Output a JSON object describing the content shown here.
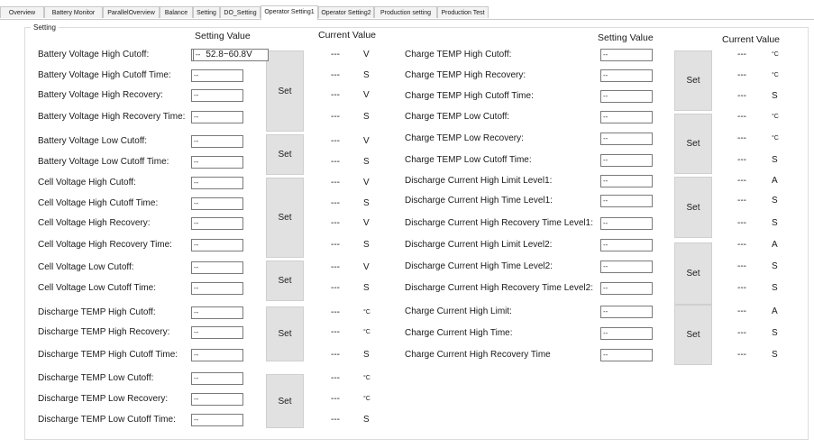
{
  "tabs": [
    "Overview",
    "Battery Monitor",
    "ParallelOverview",
    "Balance",
    "Setting",
    "DO_Setting",
    "Operator Setting1",
    "Operator Setting2",
    "Production setting",
    "Production Test"
  ],
  "active_tab": "Operator Setting1",
  "group_title": "Setting",
  "headers": {
    "setting_value": "Setting Value",
    "current_value": "Current Value"
  },
  "placeholder": "--",
  "current_placeholder": "---",
  "set_label": "Set",
  "tooltip": "52.8~60.8V",
  "left_rows": [
    {
      "label": "Battery Voltage High Cutoff:",
      "unit": "V"
    },
    {
      "label": "Battery Voltage High Cutoff Time:",
      "unit": "S"
    },
    {
      "label": "Battery Voltage High Recovery:",
      "unit": "V"
    },
    {
      "label": "Battery Voltage High Recovery Time:",
      "unit": "S"
    },
    {
      "label": "Battery Voltage Low Cutoff:",
      "unit": "V"
    },
    {
      "label": "Battery Voltage Low Cutoff Time:",
      "unit": "S"
    },
    {
      "label": "Cell Voltage High Cutoff:",
      "unit": "V"
    },
    {
      "label": "Cell Voltage High Cutoff Time:",
      "unit": "S"
    },
    {
      "label": "Cell Voltage High Recovery:",
      "unit": "V"
    },
    {
      "label": "Cell Voltage High Recovery Time:",
      "unit": "S"
    },
    {
      "label": "Cell Voltage Low Cutoff:",
      "unit": "V"
    },
    {
      "label": "Cell Voltage Low Cutoff Time:",
      "unit": "S"
    },
    {
      "label": "Discharge TEMP High Cutoff:",
      "unit": "°C"
    },
    {
      "label": "Discharge TEMP High Recovery:",
      "unit": "°C"
    },
    {
      "label": "Discharge TEMP High Cutoff Time:",
      "unit": "S"
    },
    {
      "label": "Discharge TEMP Low Cutoff:",
      "unit": "°C"
    },
    {
      "label": "Discharge TEMP Low Recovery:",
      "unit": "°C"
    },
    {
      "label": "Discharge TEMP Low Cutoff Time:",
      "unit": "S"
    }
  ],
  "right_rows": [
    {
      "label": "Charge TEMP High Cutoff:",
      "unit": "°C"
    },
    {
      "label": "Charge TEMP High Recovery:",
      "unit": "°C"
    },
    {
      "label": "Charge TEMP High Cutoff Time:",
      "unit": "S"
    },
    {
      "label": "Charge TEMP Low Cutoff:",
      "unit": "°C"
    },
    {
      "label": "Charge TEMP Low Recovery:",
      "unit": "°C"
    },
    {
      "label": "Charge TEMP Low Cutoff Time:",
      "unit": "S"
    },
    {
      "label": "Discharge Current High Limit Level1:",
      "unit": "A"
    },
    {
      "label": "Discharge Current High Time Level1:",
      "unit": "S"
    },
    {
      "label": "Discharge Current High Recovery Time Level1:",
      "unit": "S"
    },
    {
      "label": "Discharge Current High Limit Level2:",
      "unit": "A"
    },
    {
      "label": "Discharge Current High Time Level2:",
      "unit": "S"
    },
    {
      "label": "Discharge Current High Recovery Time Level2:",
      "unit": "S"
    },
    {
      "label": "Charge Current High Limit:",
      "unit": "A"
    },
    {
      "label": "Charge Current High Time:",
      "unit": "S"
    },
    {
      "label": "Charge Current High Recovery Time",
      "unit": "S"
    }
  ]
}
